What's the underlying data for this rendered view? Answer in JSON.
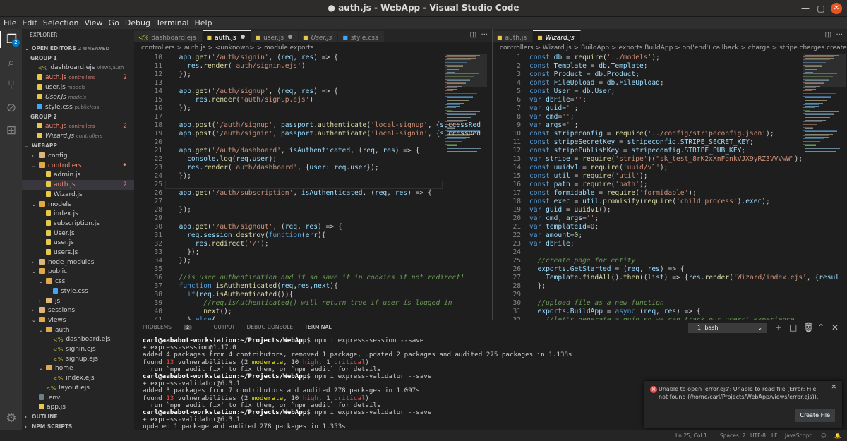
{
  "window": {
    "title": "● auth.js - WebApp - Visual Studio Code"
  },
  "menu": [
    "File",
    "Edit",
    "Selection",
    "View",
    "Go",
    "Debug",
    "Terminal",
    "Help"
  ],
  "activity": {
    "scm_badge": "2"
  },
  "sidebar": {
    "title": "EXPLORER",
    "open_editors": "OPEN EDITORS",
    "unsaved": "2 UNSAVED",
    "group1": "GROUP 1",
    "group2": "GROUP 2",
    "g1": [
      {
        "name": "dashboard.ejs",
        "path": "views/auth"
      },
      {
        "name": "auth.js",
        "path": "controllers",
        "count": "2"
      },
      {
        "name": "user.js",
        "path": "models"
      },
      {
        "name": "User.js",
        "path": "models"
      },
      {
        "name": "style.css",
        "path": "public/css"
      }
    ],
    "g2": [
      {
        "name": "auth.js",
        "path": "controllers",
        "count": "2"
      },
      {
        "name": "Wizard.js",
        "path": "controllers"
      }
    ],
    "project": "WEBAPP",
    "tree": [
      "config",
      "controllers",
      "admin.js",
      "auth.js",
      "Wizard.js",
      "models",
      "index.js",
      "subscription.js",
      "User.js",
      "user.js",
      "users.js",
      "node_modules",
      "public",
      "css",
      "style.css",
      "js",
      "sessions",
      "views",
      "auth",
      "dashboard.ejs",
      "signin.ejs",
      "signup.ejs",
      "home",
      "index.ejs",
      "layout.ejs",
      ".env",
      "app.js"
    ],
    "tree_count": "2",
    "outline": "OUTLINE",
    "npm": "NPM SCRIPTS"
  },
  "editor1": {
    "tabs": [
      "dashboard.ejs",
      "auth.js",
      "user.js",
      "User.js",
      "style.css"
    ],
    "breadcrumb": [
      "controllers",
      ">",
      "auth.js",
      ">",
      "<unknown>",
      ">",
      "module.exports"
    ],
    "line_numbers": [
      "10",
      "11",
      "12",
      "13",
      "14",
      "15",
      "16",
      "17",
      "18",
      "19",
      "20",
      "21",
      "22",
      "23",
      "24",
      "25",
      "26",
      "27",
      "28",
      "29",
      "30",
      "31",
      "32",
      "33",
      "34",
      "35",
      "36",
      "37",
      "38",
      "39",
      "40",
      "41"
    ],
    "lines": [
      "  app.get('/auth/signin', (req, res) => {",
      "    res.render('auth/signin.ejs')",
      "  });",
      "",
      "  app.get('/auth/signup', (req, res) => {",
      "      res.render('auth/signup.ejs')",
      "  });",
      "",
      "  app.post('/auth/signup', passport.authenticate('local-signup', {successRed",
      "  app.post('/auth/signin', passport.authenticate('local-signin', {successRed",
      "",
      "  app.get('/auth/dashboard', isAuthenticated, (req, res) => {",
      "    console.log(req.user);",
      "    res.render('auth/dashboard', {user: req.user});",
      "  });",
      "",
      "  app.get('/auth/subscription', isAuthenticated, (req, res) => {",
      "",
      "  });",
      "",
      "  app.get('/auth/signout', (req, res) => {",
      "    req.session.destroy(function(err){",
      "      res.redirect('/');",
      "    });",
      "  });",
      "",
      "  //is user authentication and if so save it in cookies if not redirect!",
      "  function isAuthenticated(req,res,next){",
      "    if(req.isAuthenticated()){",
      "        //req.isAuthenticated() will return true if user is logged in",
      "        next();",
      "    } else{"
    ]
  },
  "editor2": {
    "tabs": [
      "auth.js",
      "Wizard.js"
    ],
    "breadcrumb": [
      "controllers",
      ">",
      "Wizard.js",
      ">",
      "BuildApp",
      ">",
      "exports.BuildApp",
      ">",
      "on('end') callback",
      ">",
      "charge",
      ">",
      "stripe.charges.create() callback"
    ],
    "line_numbers": [
      "1",
      "2",
      "3",
      "4",
      "5",
      "6",
      "7",
      "8",
      "9",
      "10",
      "11",
      "12",
      "13",
      "14",
      "15",
      "16",
      "17",
      "18",
      "19",
      "20",
      "21",
      "22",
      "23",
      "24",
      "25",
      "26",
      "27",
      "28",
      "29",
      "30",
      "31",
      "32"
    ],
    "lines": [
      "const db = require('../models');",
      "const Template = db.Template;",
      "const Product = db.Product;",
      "const FileUpload = db.FileUpload;",
      "const User = db.User;",
      "var dbFile='';",
      "var guid='';",
      "var cmd='';",
      "var args='';",
      "const stripeconfig = require('../config/stripeconfig.json');",
      "const stripeSecretKey = stripeconfig.STRIPE_SECRET_KEY;",
      "const stripePublishKey = stripeconfig.STRIPE_PUB_KEY;",
      "var stripe = require('stripe')(\"sk_test_8rK2xXnFgnkVJX9yRZ3VVVwW\");",
      "const uuidv1 = require('uuid/v1');",
      "const util = require('util');",
      "const path = require('path');",
      "const formidable = require('formidable');",
      "const exec = util.promisify(require('child_process').exec);",
      "var guid = uuidv1();",
      "var cmd, args='';",
      "var templateId=0;",
      "var amount=0;",
      "var dbFile;",
      "",
      "  //create page for entity",
      "  exports.GetStarted = (req, res) => {",
      "    Template.findAll().then((list) => {res.render('Wizard/index.ejs', {resul",
      "  };",
      "",
      "  //upload file as a new function",
      "  exports.BuildApp = async (req, res) => {",
      "    //let's generate a guid so we can track our users' experience"
    ]
  },
  "panel": {
    "tabs": [
      "PROBLEMS",
      "OUTPUT",
      "DEBUG CONSOLE",
      "TERMINAL"
    ],
    "problems_count": "2",
    "shell": "1: bash",
    "terminal": [
      {
        "u": "carl@aababot-workstation",
        "p": "~/Projects/WebApp",
        "cmd": "$ npm i express-session --save"
      },
      {
        "t": "+ express-session@1.17.0"
      },
      {
        "t": "added 4 packages from 4 contributors, removed 1 package, updated 2 packages and audited 275 packages in 1.138s"
      },
      {
        "a": "found ",
        "b": "13",
        "c": " vulnerabilities (2 ",
        "d": "moderate",
        "e": ", 10 ",
        "f": "high",
        "g": ", 1 ",
        "h": "critical",
        "i": ")"
      },
      {
        "t": "  run `npm audit fix` to fix them, or `npm audit` for details"
      },
      {
        "u": "carl@aababot-workstation",
        "p": "~/Projects/WebApp",
        "cmd": "$ npm i express-validator --save"
      },
      {
        "t": "+ express-validator@6.3.1"
      },
      {
        "t": "added 3 packages from 7 contributors and audited 278 packages in 1.097s"
      },
      {
        "a": "found ",
        "b": "13",
        "c": " vulnerabilities (2 ",
        "d": "moderate",
        "e": ", 10 ",
        "f": "high",
        "g": ", 1 ",
        "h": "critical",
        "i": ")"
      },
      {
        "t": "  run `npm audit fix` to fix them, or `npm audit` for details"
      },
      {
        "u": "carl@aababot-workstation",
        "p": "~/Projects/WebApp",
        "cmd": "$ npm i express-validator --save"
      },
      {
        "t": "+ express-validator@6.3.1"
      },
      {
        "t": "updated 1 package and audited 278 packages in 1.353s"
      }
    ]
  },
  "notification": {
    "message": "Unable to open 'error.ejs': Unable to read file (Error: File not found (/home/carl/Projects/WebApp/views/error.ejs)).",
    "button": "Create File"
  },
  "status": {
    "position": "Ln 25, Col 1",
    "spaces": "Spaces: 2",
    "encoding": "UTF-8",
    "eol": "LF",
    "language": "JavaScript"
  }
}
